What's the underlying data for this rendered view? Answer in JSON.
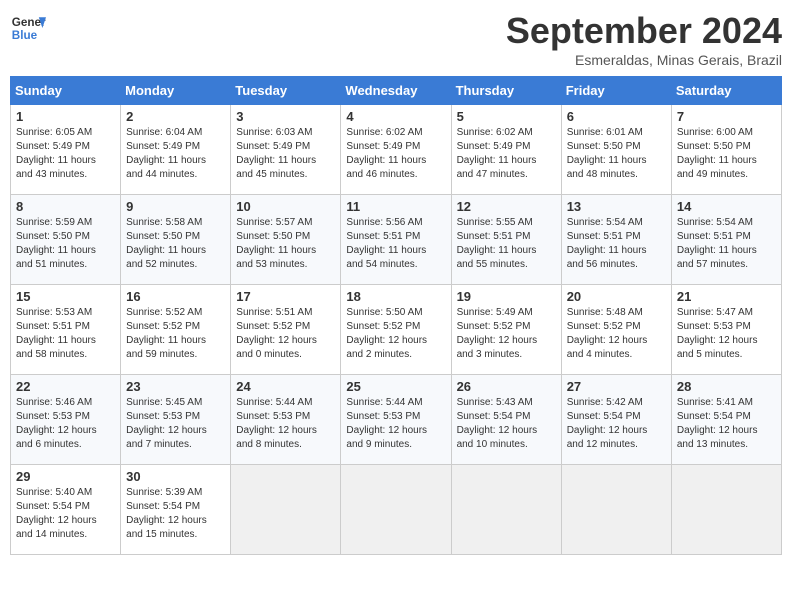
{
  "logo": {
    "line1": "General",
    "line2": "Blue"
  },
  "title": "September 2024",
  "subtitle": "Esmeraldas, Minas Gerais, Brazil",
  "weekdays": [
    "Sunday",
    "Monday",
    "Tuesday",
    "Wednesday",
    "Thursday",
    "Friday",
    "Saturday"
  ],
  "weeks": [
    [
      {
        "day": 1,
        "info": "Sunrise: 6:05 AM\nSunset: 5:49 PM\nDaylight: 11 hours\nand 43 minutes."
      },
      {
        "day": 2,
        "info": "Sunrise: 6:04 AM\nSunset: 5:49 PM\nDaylight: 11 hours\nand 44 minutes."
      },
      {
        "day": 3,
        "info": "Sunrise: 6:03 AM\nSunset: 5:49 PM\nDaylight: 11 hours\nand 45 minutes."
      },
      {
        "day": 4,
        "info": "Sunrise: 6:02 AM\nSunset: 5:49 PM\nDaylight: 11 hours\nand 46 minutes."
      },
      {
        "day": 5,
        "info": "Sunrise: 6:02 AM\nSunset: 5:49 PM\nDaylight: 11 hours\nand 47 minutes."
      },
      {
        "day": 6,
        "info": "Sunrise: 6:01 AM\nSunset: 5:50 PM\nDaylight: 11 hours\nand 48 minutes."
      },
      {
        "day": 7,
        "info": "Sunrise: 6:00 AM\nSunset: 5:50 PM\nDaylight: 11 hours\nand 49 minutes."
      }
    ],
    [
      {
        "day": 8,
        "info": "Sunrise: 5:59 AM\nSunset: 5:50 PM\nDaylight: 11 hours\nand 51 minutes."
      },
      {
        "day": 9,
        "info": "Sunrise: 5:58 AM\nSunset: 5:50 PM\nDaylight: 11 hours\nand 52 minutes."
      },
      {
        "day": 10,
        "info": "Sunrise: 5:57 AM\nSunset: 5:50 PM\nDaylight: 11 hours\nand 53 minutes."
      },
      {
        "day": 11,
        "info": "Sunrise: 5:56 AM\nSunset: 5:51 PM\nDaylight: 11 hours\nand 54 minutes."
      },
      {
        "day": 12,
        "info": "Sunrise: 5:55 AM\nSunset: 5:51 PM\nDaylight: 11 hours\nand 55 minutes."
      },
      {
        "day": 13,
        "info": "Sunrise: 5:54 AM\nSunset: 5:51 PM\nDaylight: 11 hours\nand 56 minutes."
      },
      {
        "day": 14,
        "info": "Sunrise: 5:54 AM\nSunset: 5:51 PM\nDaylight: 11 hours\nand 57 minutes."
      }
    ],
    [
      {
        "day": 15,
        "info": "Sunrise: 5:53 AM\nSunset: 5:51 PM\nDaylight: 11 hours\nand 58 minutes."
      },
      {
        "day": 16,
        "info": "Sunrise: 5:52 AM\nSunset: 5:52 PM\nDaylight: 11 hours\nand 59 minutes."
      },
      {
        "day": 17,
        "info": "Sunrise: 5:51 AM\nSunset: 5:52 PM\nDaylight: 12 hours\nand 0 minutes."
      },
      {
        "day": 18,
        "info": "Sunrise: 5:50 AM\nSunset: 5:52 PM\nDaylight: 12 hours\nand 2 minutes."
      },
      {
        "day": 19,
        "info": "Sunrise: 5:49 AM\nSunset: 5:52 PM\nDaylight: 12 hours\nand 3 minutes."
      },
      {
        "day": 20,
        "info": "Sunrise: 5:48 AM\nSunset: 5:52 PM\nDaylight: 12 hours\nand 4 minutes."
      },
      {
        "day": 21,
        "info": "Sunrise: 5:47 AM\nSunset: 5:53 PM\nDaylight: 12 hours\nand 5 minutes."
      }
    ],
    [
      {
        "day": 22,
        "info": "Sunrise: 5:46 AM\nSunset: 5:53 PM\nDaylight: 12 hours\nand 6 minutes."
      },
      {
        "day": 23,
        "info": "Sunrise: 5:45 AM\nSunset: 5:53 PM\nDaylight: 12 hours\nand 7 minutes."
      },
      {
        "day": 24,
        "info": "Sunrise: 5:44 AM\nSunset: 5:53 PM\nDaylight: 12 hours\nand 8 minutes."
      },
      {
        "day": 25,
        "info": "Sunrise: 5:44 AM\nSunset: 5:53 PM\nDaylight: 12 hours\nand 9 minutes."
      },
      {
        "day": 26,
        "info": "Sunrise: 5:43 AM\nSunset: 5:54 PM\nDaylight: 12 hours\nand 10 minutes."
      },
      {
        "day": 27,
        "info": "Sunrise: 5:42 AM\nSunset: 5:54 PM\nDaylight: 12 hours\nand 12 minutes."
      },
      {
        "day": 28,
        "info": "Sunrise: 5:41 AM\nSunset: 5:54 PM\nDaylight: 12 hours\nand 13 minutes."
      }
    ],
    [
      {
        "day": 29,
        "info": "Sunrise: 5:40 AM\nSunset: 5:54 PM\nDaylight: 12 hours\nand 14 minutes."
      },
      {
        "day": 30,
        "info": "Sunrise: 5:39 AM\nSunset: 5:54 PM\nDaylight: 12 hours\nand 15 minutes."
      },
      null,
      null,
      null,
      null,
      null
    ]
  ]
}
